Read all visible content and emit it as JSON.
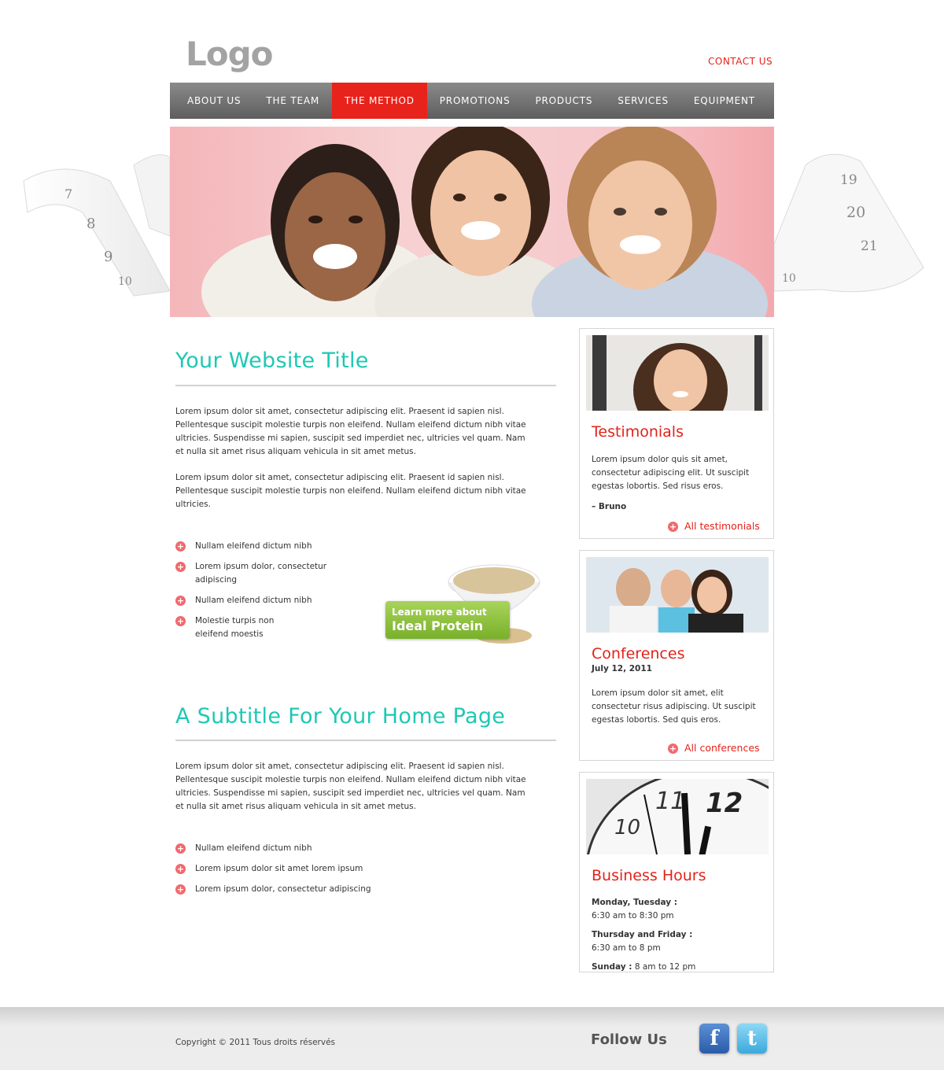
{
  "header": {
    "logo": "Logo",
    "contact": "CONTACT US"
  },
  "nav": {
    "items": [
      "ABOUT US",
      "THE TEAM",
      "THE METHOD",
      "PROMOTIONS",
      "PRODUCTS",
      "SERVICES",
      "EQUIPMENT"
    ],
    "active": "THE METHOD"
  },
  "main": {
    "title": "Your Website Title",
    "paragraphs": [
      "Lorem ipsum dolor sit amet, consectetur adipiscing elit. Praesent id sapien nisl. Pellentesque suscipit molestie turpis non eleifend. Nullam eleifend dictum nibh vitae ultricies. Suspendisse mi sapien, suscipit sed imperdiet nec, ultricies vel quam. Nam et nulla sit amet risus aliquam vehicula in sit amet metus.",
      "Lorem ipsum dolor sit amet, consectetur adipiscing elit. Praesent id sapien nisl. Pellentesque suscipit molestie turpis non eleifend. Nullam eleifend dictum nibh vitae ultricies."
    ],
    "bullets": [
      "Nullam eleifend dictum nibh",
      "Lorem ipsum dolor, consectetur adipiscing",
      "Nullam eleifend dictum nibh",
      "Molestie turpis non eleifend moestis"
    ],
    "promo": {
      "line1": "Learn more about",
      "line2": "Ideal Protein"
    },
    "subtitle": "A Subtitle For Your Home Page",
    "paragraph3": "Lorem ipsum dolor sit amet, consectetur adipiscing elit. Praesent id sapien nisl. Pellentesque suscipit molestie turpis non eleifend. Nullam eleifend dictum nibh vitae ultricies. Suspendisse mi sapien, suscipit sed imperdiet nec, ultricies vel quam. Nam et nulla sit amet risus aliquam vehicula in sit amet metus.",
    "bullets2": [
      "Nullam eleifend dictum nibh",
      "Lorem ipsum dolor sit amet lorem ipsum",
      "Lorem ipsum dolor, consectetur adipiscing"
    ]
  },
  "sidebar": {
    "testimonials": {
      "title": "Testimonials",
      "text": "Lorem ipsum dolor quis sit amet, consectetur adipiscing elit. Ut suscipit egestas lobortis. Sed risus eros.",
      "author": "– Bruno",
      "link": "All testimonials"
    },
    "conferences": {
      "title": "Conferences",
      "date": "July 12, 2011",
      "text": "Lorem ipsum dolor sit amet, elit consectetur risus adipiscing. Ut suscipit egestas lobortis. Sed quis eros.",
      "link": "All conferences"
    },
    "hours": {
      "title": "Business Hours",
      "clock_numbers": [
        "10",
        "11",
        "12"
      ],
      "rows": [
        {
          "label": "Monday, Tuesday :",
          "value": "6:30 am to 8:30 pm"
        },
        {
          "label": "Thursday and Friday :",
          "value": "6:30 am to 8 pm"
        },
        {
          "label": "Sunday :",
          "value": "8 am to 12 pm"
        }
      ]
    }
  },
  "footer": {
    "copyright": "Copyright © 2011 Tous droits réservés",
    "follow": "Follow Us",
    "social": [
      "facebook-icon",
      "twitter-icon"
    ]
  },
  "tape_numbers_left": [
    "7",
    "8",
    "9",
    "10"
  ],
  "tape_numbers_right": [
    "19",
    "20",
    "21",
    "10"
  ],
  "colors": {
    "accent": "#e2231a",
    "title": "#1ec8b4",
    "nav": "#6e6e6e"
  }
}
